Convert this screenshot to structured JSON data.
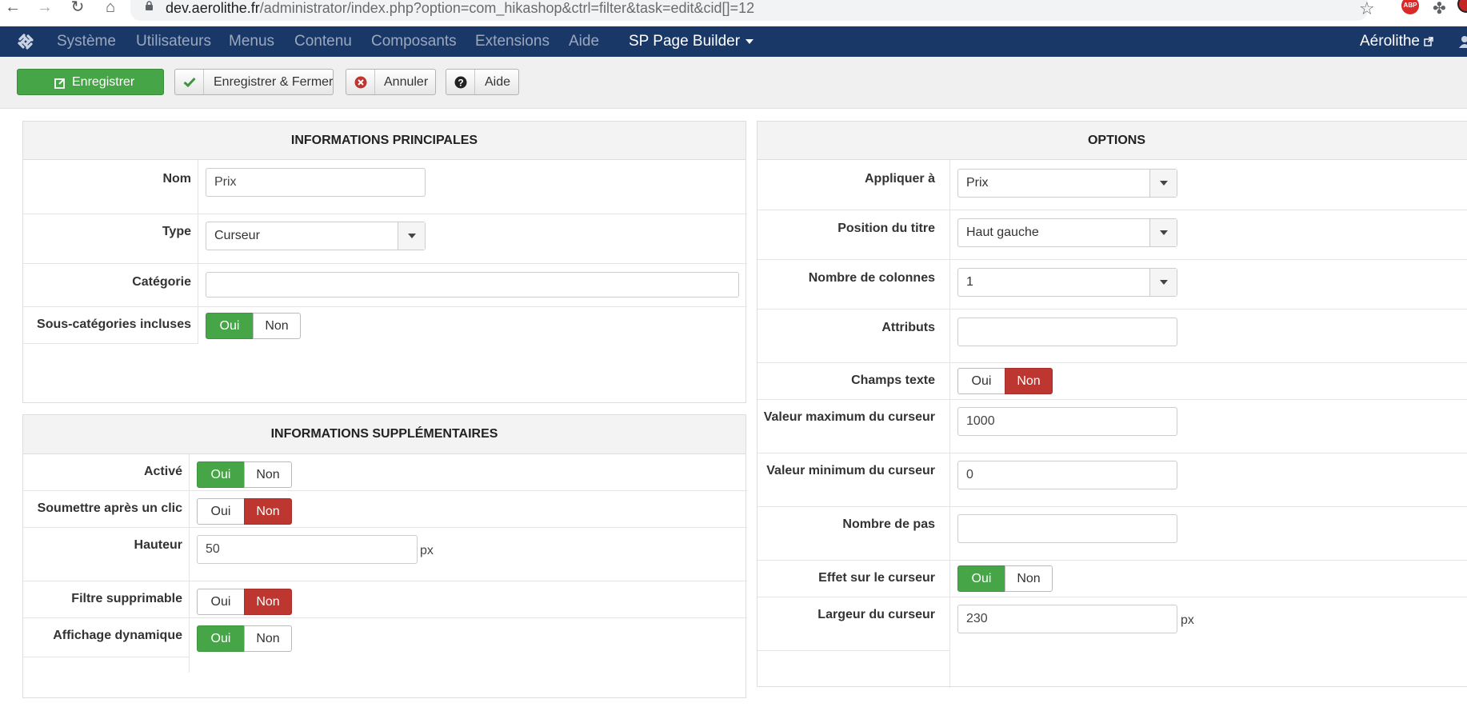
{
  "browser": {
    "url_host": "dev.aerolithe.fr",
    "url_path": "/administrator/index.php?option=com_hikashop&ctrl=filter&task=edit&cid[]=12",
    "abp_label": "ABP"
  },
  "topnav": {
    "menu": [
      "Système",
      "Utilisateurs",
      "Menus",
      "Contenu",
      "Composants",
      "Extensions",
      "Aide"
    ],
    "page_builder": "SP Page Builder",
    "site": "Aérolithe"
  },
  "toolbar": {
    "save": "Enregistrer",
    "save_close": "Enregistrer & Fermer",
    "cancel": "Annuler",
    "help": "Aide"
  },
  "toggle_labels": {
    "yes": "Oui",
    "no": "Non"
  },
  "main_panel": {
    "title": "INFORMATIONS PRINCIPALES",
    "name_label": "Nom",
    "name_value": "Prix",
    "type_label": "Type",
    "type_value": "Curseur",
    "category_label": "Catégorie",
    "category_value": "",
    "subcats_label": "Sous-catégories incluses",
    "subcats_value": "Oui"
  },
  "extra_panel": {
    "title": "INFORMATIONS SUPPLÉMENTAIRES",
    "active_label": "Activé",
    "active_value": "Oui",
    "submit_label": "Soumettre après un clic",
    "submit_value": "Non",
    "height_label": "Hauteur",
    "height_value": "50",
    "height_unit": "px",
    "removable_label": "Filtre supprimable",
    "removable_value": "Non",
    "dynamic_label": "Affichage dynamique",
    "dynamic_value": "Oui"
  },
  "options_panel": {
    "title": "OPTIONS",
    "apply_label": "Appliquer à",
    "apply_value": "Prix",
    "title_pos_label": "Position du titre",
    "title_pos_value": "Haut gauche",
    "columns_label": "Nombre de colonnes",
    "columns_value": "1",
    "attributes_label": "Attributs",
    "attributes_value": "",
    "textfields_label": "Champs texte",
    "textfields_value": "Non",
    "max_label": "Valeur maximum du curseur",
    "max_value": "1000",
    "min_label": "Valeur minimum du curseur",
    "min_value": "0",
    "steps_label": "Nombre de pas",
    "steps_value": "",
    "effect_label": "Effet sur le curseur",
    "effect_value": "Oui",
    "width_label": "Largeur du curseur",
    "width_value": "230",
    "width_unit": "px"
  },
  "colors": {
    "nav_bg": "#1a3867",
    "save_green": "#46a546",
    "toggle_yes": "#46a546",
    "toggle_no": "#bd362f"
  }
}
